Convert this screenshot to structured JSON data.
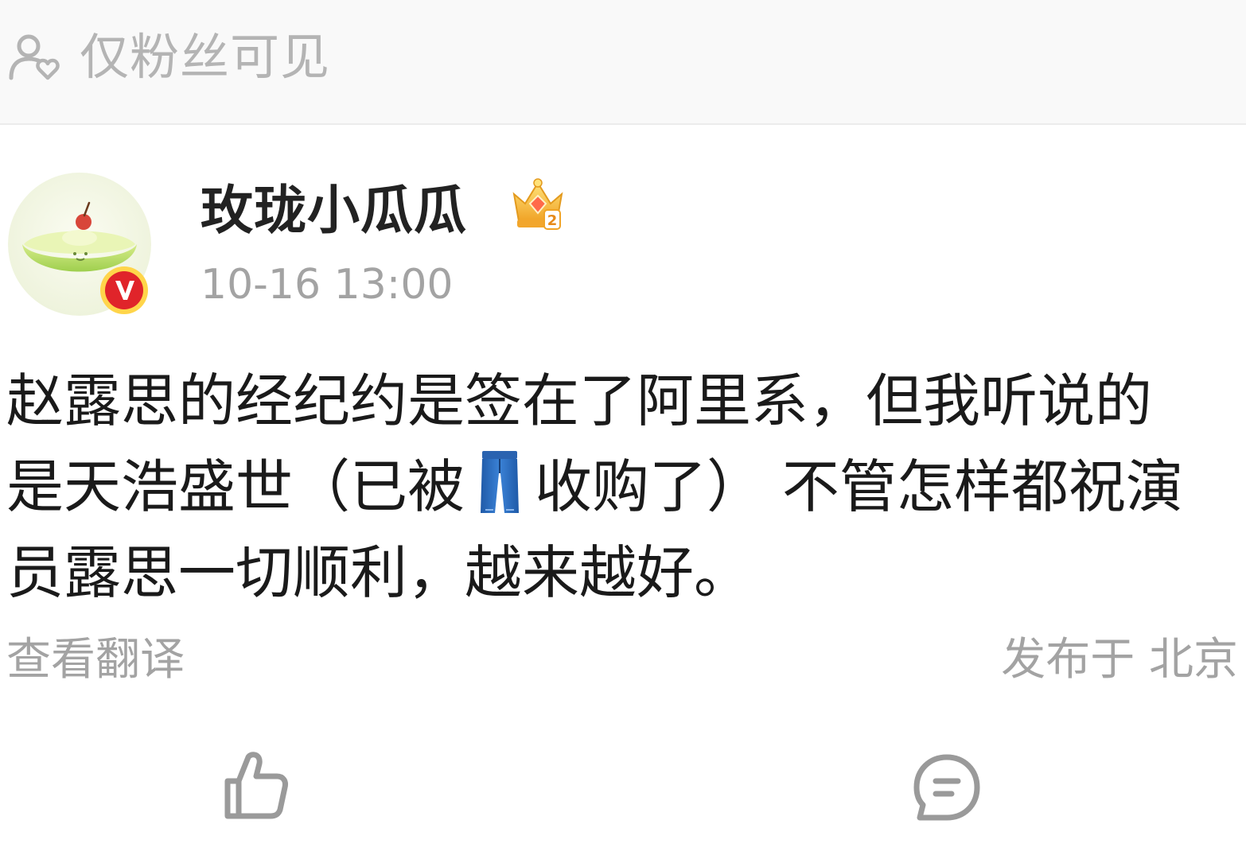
{
  "visibility": {
    "label": "仅粉丝可见",
    "icon": "fans-only-icon"
  },
  "author": {
    "name": "玫珑小瓜瓜",
    "post_time": "10-16 13:00",
    "avatar_icon": "melon-avatar",
    "verified_icon": "verified-v-icon",
    "badge_icon": "crown-level-icon",
    "badge_level": "2"
  },
  "post": {
    "lines": [
      "赵露思的经纪约是签在了阿里系，但我听说的",
      "是天浩盛世（已被",
      "收购了） 不管怎样都祝演",
      "员露思一切顺利，越来越好。"
    ],
    "inline_emoji": "jeans-emoji"
  },
  "meta": {
    "translate_label": "查看翻译",
    "location_label": "发布于 北京"
  },
  "actions": {
    "like_icon": "thumbs-up-icon",
    "comment_icon": "comment-icon"
  },
  "colors": {
    "header_bg": "#f9f9f9",
    "muted_text": "#a3a3a3",
    "body_text": "#1a1a1a",
    "verified_red": "#e0242a",
    "crown_gold": "#f5b93a",
    "jeans_blue": "#2f6fc0",
    "icon_gray": "#9a9a9a"
  }
}
